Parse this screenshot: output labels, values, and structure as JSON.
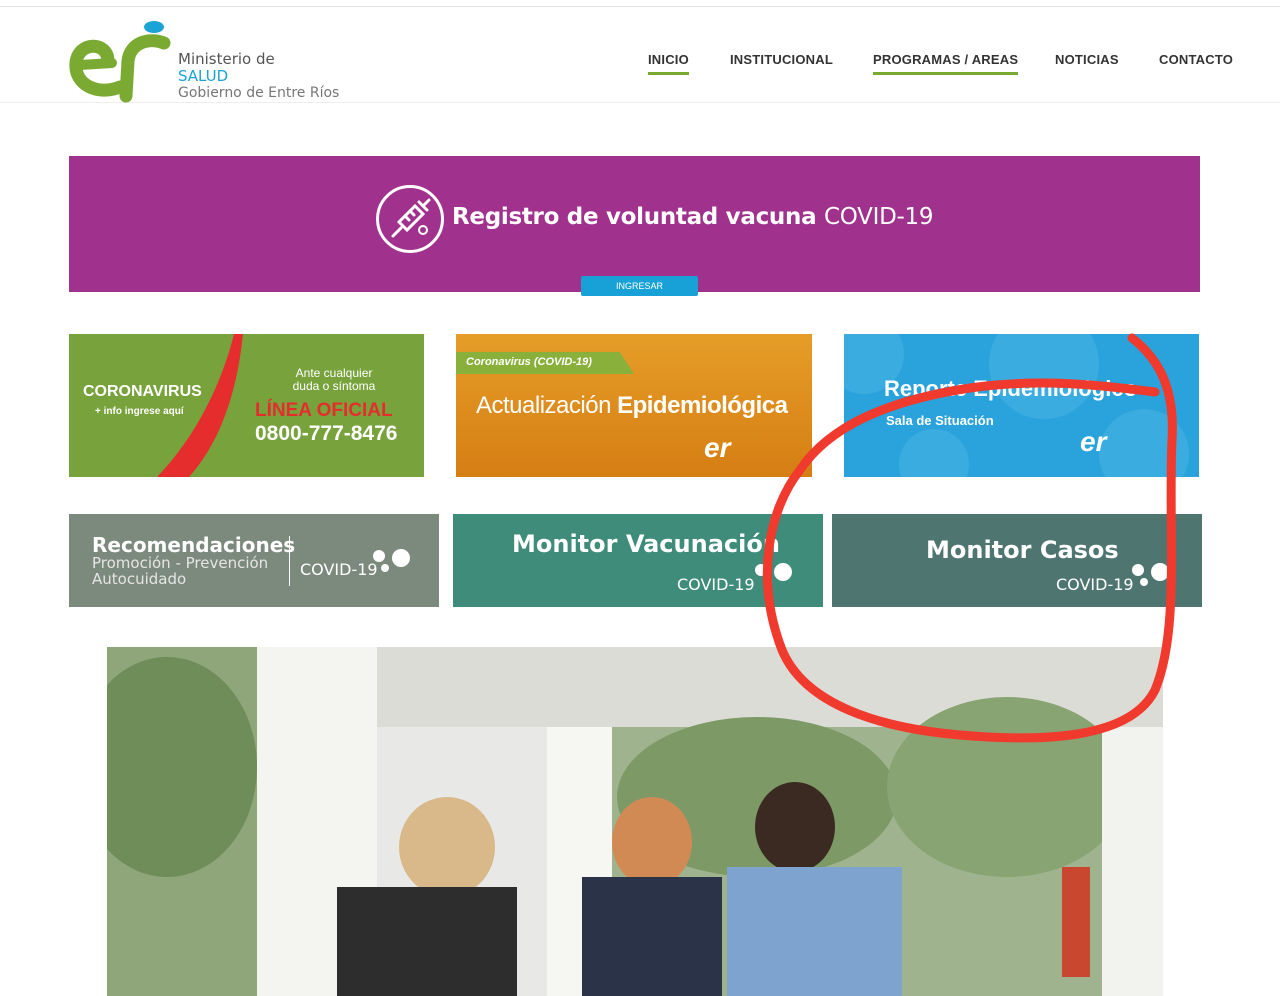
{
  "logo": {
    "line1": "Ministerio de",
    "line2": "SALUD",
    "line3": "Gobierno de Entre Ríos"
  },
  "nav": [
    {
      "label": "INICIO",
      "active": true
    },
    {
      "label": "INSTITUCIONAL",
      "active": false
    },
    {
      "label": "PROGRAMAS / AREAS",
      "active": true
    },
    {
      "label": "NOTICIAS",
      "active": false
    },
    {
      "label": "CONTACTO",
      "active": false
    }
  ],
  "banner": {
    "title_bold": "Registro de voluntad vacuna",
    "title_thin": "COVID-19",
    "button": "INGRESAR"
  },
  "tile_coronavirus": {
    "title": "CORONAVIRUS",
    "subtitle": "+ info ingrese aquí",
    "line1": "Ante cualquier",
    "line2": "duda o síntoma",
    "line3": "LÍNEA OFICIAL",
    "phone": "0800-777-8476"
  },
  "tile_actualizacion": {
    "tag": "Coronavirus (COVID-19)",
    "title_thin": "Actualización",
    "title_bold": "Epidemiológica"
  },
  "tile_reporte": {
    "title": "Reporte Epidemiológico",
    "subtitle": "Sala de Situación"
  },
  "card_recomendaciones": {
    "title": "Recomendaciones",
    "line2": "Promoción - Prevención",
    "line3": "Autocuidado",
    "covid": "COVID-19"
  },
  "card_vacunacion": {
    "title": "Monitor Vacunación",
    "covid": "COVID-19"
  },
  "card_casos": {
    "title": "Monitor Casos",
    "covid": "COVID-19"
  },
  "colors": {
    "brand_green": "#7aaa32",
    "banner_purple": "#a0328e",
    "accent_blue": "#18a1d6",
    "annotation_red": "#f03a2e"
  }
}
